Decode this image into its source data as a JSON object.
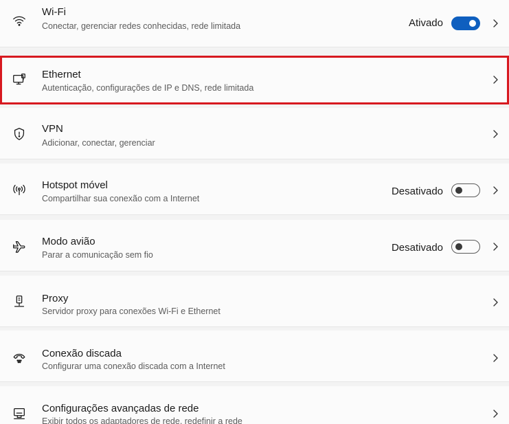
{
  "colors": {
    "accent": "#0f5fbf",
    "highlight_border": "#d71920"
  },
  "rows": [
    {
      "icon": "wifi-icon",
      "title": "Wi-Fi",
      "subtitle": "Conectar, gerenciar redes conhecidas, rede limitada",
      "status": "Ativado",
      "toggle": "on"
    },
    {
      "icon": "ethernet-icon",
      "title": "Ethernet",
      "subtitle": "Autenticação, configurações de IP e DNS, rede limitada"
    },
    {
      "icon": "vpn-shield-icon",
      "title": "VPN",
      "subtitle": "Adicionar, conectar, gerenciar"
    },
    {
      "icon": "hotspot-icon",
      "title": "Hotspot móvel",
      "subtitle": "Compartilhar sua conexão com a Internet",
      "status": "Desativado",
      "toggle": "off"
    },
    {
      "icon": "airplane-icon",
      "title": "Modo avião",
      "subtitle": "Parar a comunicação sem fio",
      "status": "Desativado",
      "toggle": "off"
    },
    {
      "icon": "proxy-icon",
      "title": "Proxy",
      "subtitle": "Servidor proxy para conexões Wi-Fi e Ethernet"
    },
    {
      "icon": "dialup-icon",
      "title": "Conexão discada",
      "subtitle": "Configurar uma conexão discada com a Internet"
    },
    {
      "icon": "advanced-network-icon",
      "title": "Configurações avançadas de rede",
      "subtitle": "Exibir todos os adaptadores de rede, redefinir a rede"
    }
  ]
}
